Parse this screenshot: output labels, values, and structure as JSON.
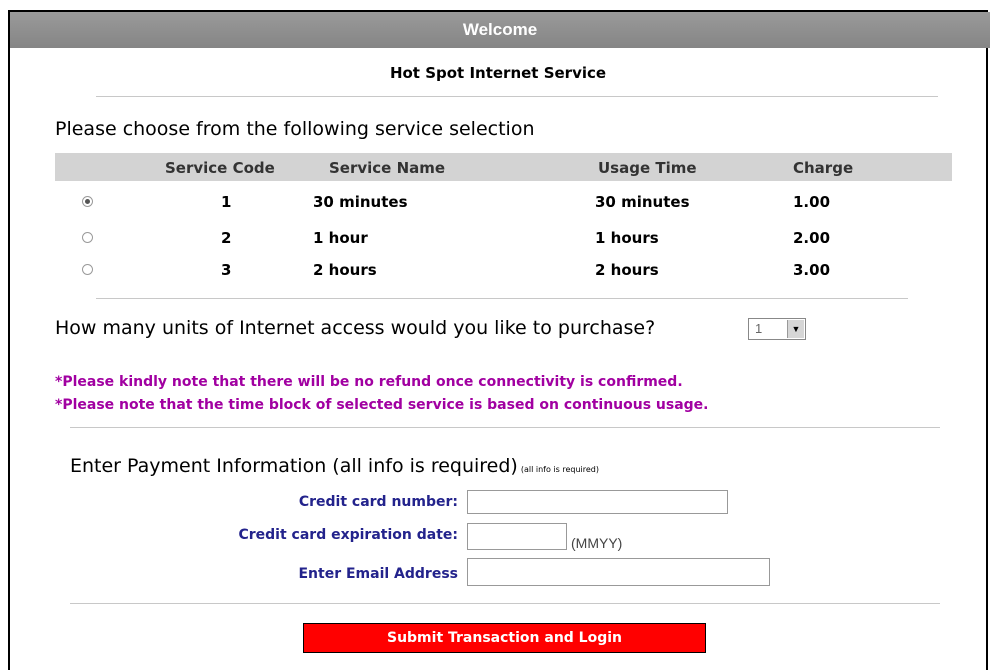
{
  "header": {
    "title": "Welcome",
    "subtitle": "Hot Spot Internet Service"
  },
  "services": {
    "heading": "Please choose from the following service selection",
    "columns": [
      "Service Code",
      "Service Name",
      "Usage Time",
      "Charge"
    ],
    "rows": [
      {
        "code": "1",
        "name": "30 minutes",
        "usage": "30 minutes",
        "charge": "1.00",
        "selected": true
      },
      {
        "code": "2",
        "name": "1 hour",
        "usage": "1 hours",
        "charge": "2.00",
        "selected": false
      },
      {
        "code": "3",
        "name": "2 hours",
        "usage": "2 hours",
        "charge": "3.00",
        "selected": false
      }
    ]
  },
  "units": {
    "question": "How many units of Internet access would you like to purchase?",
    "selected": "1"
  },
  "notes": [
    "*Please kindly note that there will be no refund once connectivity is confirmed.",
    "*Please note that the time block of selected service is based on continuous usage."
  ],
  "payment": {
    "heading": "Enter Payment Information (all info is required)",
    "heading_small": "(all info is required)",
    "card_number_label": "Credit card number:",
    "card_number_value": "",
    "expiration_label": "Credit card expiration date:",
    "expiration_value": "",
    "expiration_hint": "(MMYY)",
    "email_label": "Enter Email Address",
    "email_value": ""
  },
  "submit_label": "Submit Transaction and Login",
  "colors": {
    "header_bar": "#8f8f8f",
    "table_header": "#d3d3d3",
    "note_text": "#a100a1",
    "form_label": "#23238c",
    "submit_button": "#ff0000"
  }
}
